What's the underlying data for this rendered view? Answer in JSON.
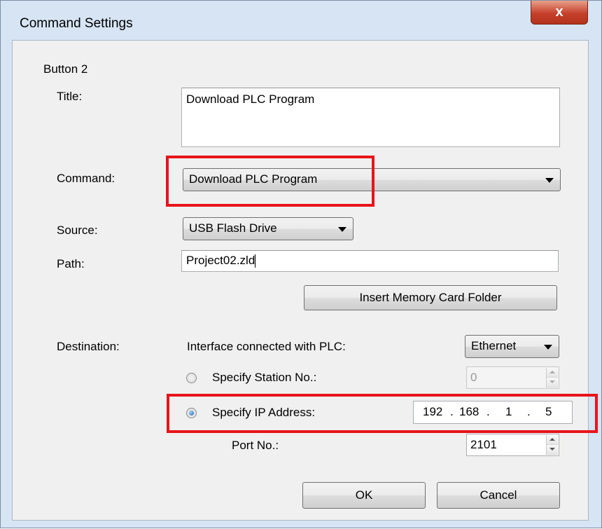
{
  "window": {
    "title": "Command Settings",
    "close_glyph": "x"
  },
  "group": {
    "label": "Button 2"
  },
  "title_field": {
    "label": "Title:",
    "value": "Download PLC Program"
  },
  "command": {
    "label": "Command:",
    "selected": "Download PLC Program"
  },
  "source": {
    "label": "Source:",
    "selected": "USB Flash Drive"
  },
  "path": {
    "label": "Path:",
    "value": "Project02.zld"
  },
  "insert_button": {
    "label": "Insert Memory Card Folder"
  },
  "destination": {
    "label": "Destination:",
    "interface_label": "Interface connected with PLC:",
    "interface_selected": "Ethernet",
    "station_radio": {
      "label": "Specify Station No.:",
      "checked": false
    },
    "station_value": "0",
    "ip_radio": {
      "label": "Specify IP Address:",
      "checked": true
    },
    "ip_octets": [
      "192",
      "168",
      "1",
      "5"
    ],
    "ip_separator": ".",
    "port_label": "Port No.:",
    "port_value": "2101"
  },
  "buttons": {
    "ok": "OK",
    "cancel": "Cancel"
  },
  "colors": {
    "highlight": "#e8141b",
    "frame": "#d6e4f3",
    "client": "#f0f0f0"
  },
  "icons": {
    "close": "close-icon",
    "dropdown": "chevron-down-icon",
    "spinner": "spin-arrows-icon"
  }
}
